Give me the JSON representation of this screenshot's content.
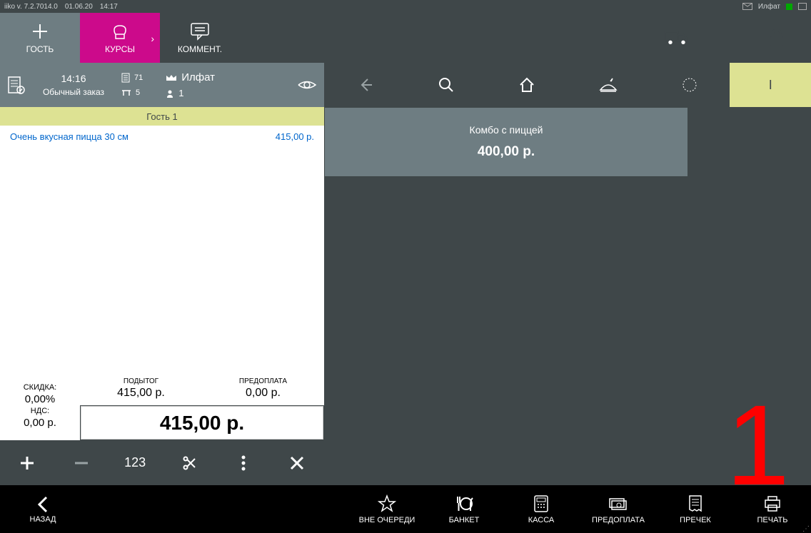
{
  "titlebar": {
    "app": "iiko  v. 7.2.7014.0",
    "date": "01.06.20",
    "time": "14:17",
    "user": "Илфат"
  },
  "topButtons": {
    "guest": "ГОСТЬ",
    "courses": "КУРСЫ",
    "comment": "КОММЕНТ."
  },
  "orderHeader": {
    "time": "14:16",
    "type": "Обычный заказ",
    "receipt": "71",
    "table": "5",
    "waiter": "Илфат",
    "guests": "1"
  },
  "guestHeader": "Гость 1",
  "orderLines": [
    {
      "name": "Очень вкусная пицца 30 см",
      "price": "415,00 р."
    }
  ],
  "totals": {
    "discountLabel": "СКИДКА:",
    "discountVal": "0,00%",
    "vatLabel": "НДС:",
    "vatVal": "0,00 р.",
    "subtotalLabel": "ПОДЫТОГ",
    "subtotalVal": "415,00 р.",
    "prepayLabel": "ПРЕДОПЛАТА",
    "prepayVal": "0,00 р.",
    "grandTotal": "415,00 р."
  },
  "midActions": {
    "num": "123"
  },
  "menuNav": {
    "category": "I"
  },
  "menuItems": [
    {
      "name": "Комбо с пиццей",
      "price": "400,00 р."
    }
  ],
  "overlay": "1",
  "bottom": {
    "back": "НАЗАД",
    "priority": "ВНЕ ОЧЕРЕДИ",
    "banquet": "БАНКЕТ",
    "cash": "КАССА",
    "prepay": "ПРЕДОПЛАТА",
    "precheck": "ПРЕЧЕК",
    "print": "ПЕЧАТЬ"
  }
}
